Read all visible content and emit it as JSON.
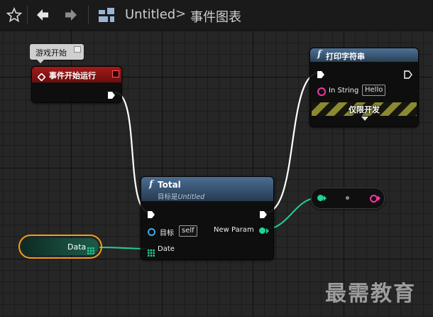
{
  "toolbar": {
    "graph_name": "Untitled",
    "graph_type": "事件图表",
    "separator": ">"
  },
  "comment": {
    "text": "游戏开始"
  },
  "event_node": {
    "title": "事件开始运行",
    "color": "#8a1212"
  },
  "print_node": {
    "title": "打印字符串",
    "in_string_label": "In String",
    "in_string_value": "Hello",
    "dev_only_label": "仅限开发",
    "header_color": "#3b5875"
  },
  "total_node": {
    "title": "Total",
    "subtitle_prefix": "目标是",
    "subtitle_target": "Untitled",
    "target_label": "目标",
    "target_value": "self",
    "date_label": "Date",
    "output_label": "New Param",
    "header_color": "#3a5a7d"
  },
  "data_node": {
    "label": "Data"
  },
  "watermark": "最需教育",
  "colors": {
    "exec_wire": "#ffffff",
    "data_wire": "#1fd19a",
    "struct_pin": "#1fd19a",
    "object_pin": "#3ea9e6",
    "string_pin": "#f03aa0",
    "selected_outline": "#f0a11a"
  }
}
